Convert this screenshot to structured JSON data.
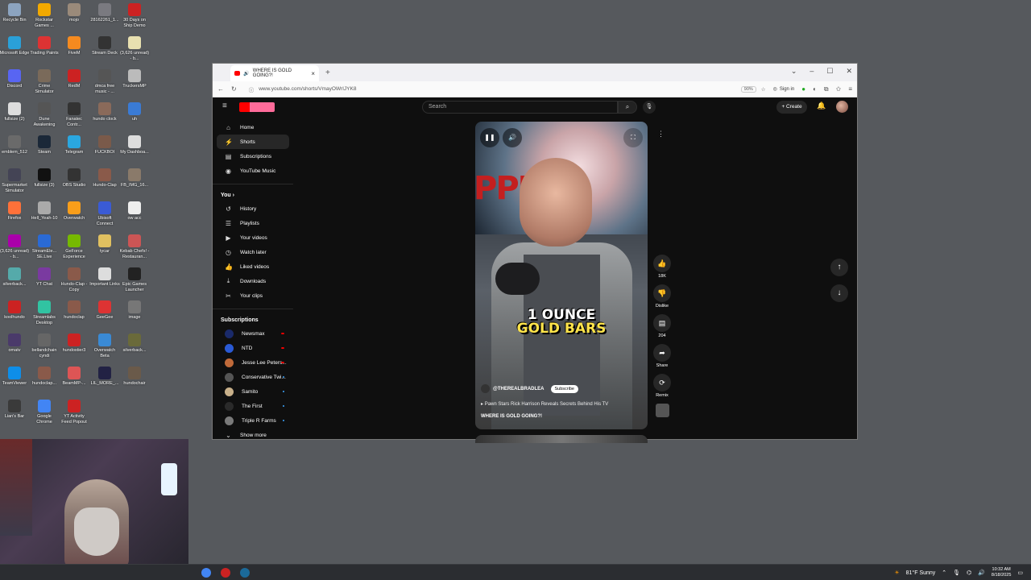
{
  "desktop": {
    "icons": [
      {
        "label": "Recycle Bin",
        "color": "#8ca4c0"
      },
      {
        "label": "Rockstar Games ...",
        "color": "#f2a900"
      },
      {
        "label": "mojo",
        "color": "#9a8a7a"
      },
      {
        "label": "28162261_1...",
        "color": "#7a7a80"
      },
      {
        "label": "30 Days on Ship Demo",
        "color": "#c22"
      },
      {
        "label": "Microsoft Edge",
        "color": "#2aa0d8"
      },
      {
        "label": "Trading Paints",
        "color": "#d33"
      },
      {
        "label": "FiveM",
        "color": "#f58a1f"
      },
      {
        "label": "Stream Deck",
        "color": "#333"
      },
      {
        "label": "(3,626 unread) - b...",
        "color": "#e8e0b0"
      },
      {
        "label": "Discord",
        "color": "#5865f2"
      },
      {
        "label": "Crime Simulator",
        "color": "#7a6a5a"
      },
      {
        "label": "RedM",
        "color": "#c22"
      },
      {
        "label": "dmca free music - ...",
        "color": "#555"
      },
      {
        "label": "TruckersMP",
        "color": "#bbb"
      },
      {
        "label": "fullsize (2)",
        "color": "#ddd"
      },
      {
        "label": "Dune Awakening",
        "color": "#555"
      },
      {
        "label": "Fanatec Contr...",
        "color": "#333"
      },
      {
        "label": "hundo clock",
        "color": "#8a6a5a"
      },
      {
        "label": "uh",
        "color": "#3a7bd5"
      },
      {
        "label": "emblem_512",
        "color": "#6a6a6a"
      },
      {
        "label": "Steam",
        "color": "#1b2838"
      },
      {
        "label": "Telegram",
        "color": "#2aa7e0"
      },
      {
        "label": "FUCKBOI",
        "color": "#7a5a4a"
      },
      {
        "label": "My Dashboa...",
        "color": "#ddd"
      },
      {
        "label": "Supermarket Simulator",
        "color": "#445"
      },
      {
        "label": "fullsize (3)",
        "color": "#111"
      },
      {
        "label": "OBS Studio",
        "color": "#333"
      },
      {
        "label": "Hundo-Clap",
        "color": "#8a5a4a"
      },
      {
        "label": "FB_IMG_16...",
        "color": "#8a7a6a"
      },
      {
        "label": "Firefox",
        "color": "#ff7139"
      },
      {
        "label": "Hell_Yeah-10",
        "color": "#aaa"
      },
      {
        "label": "Overwatch",
        "color": "#f99e1a"
      },
      {
        "label": "Ubisoft Connect",
        "color": "#3a5bd5"
      },
      {
        "label": "ow acc",
        "color": "#eee"
      },
      {
        "label": "(3,626 unread) - b...",
        "color": "#a0a"
      },
      {
        "label": "StreamEle... SE.Live",
        "color": "#2a6ad5"
      },
      {
        "label": "GeForce Experience",
        "color": "#76b900"
      },
      {
        "label": "tycar",
        "color": "#e0c060"
      },
      {
        "label": "Kebab Chefs! - Restauran...",
        "color": "#c55"
      },
      {
        "label": "silverback...",
        "color": "#5aa"
      },
      {
        "label": "YT Chat",
        "color": "#7a3aa0"
      },
      {
        "label": "Hundo-Clap - Copy",
        "color": "#8a5a4a"
      },
      {
        "label": "Important Links",
        "color": "#ddd"
      },
      {
        "label": "Epic Games Launcher",
        "color": "#222"
      },
      {
        "label": "koolhundo",
        "color": "#c22"
      },
      {
        "label": "Streamlabs Desktop",
        "color": "#31c3a2"
      },
      {
        "label": "hundoclap",
        "color": "#8a5a4a"
      },
      {
        "label": "GeeGee",
        "color": "#d33"
      },
      {
        "label": "image",
        "color": "#777"
      },
      {
        "label": "omatv",
        "color": "#4a3a6a"
      },
      {
        "label": "bellandchain cyndi",
        "color": "#666"
      },
      {
        "label": "hundostier3",
        "color": "#c22"
      },
      {
        "label": "Overwatch Beta",
        "color": "#3a8ad5"
      },
      {
        "label": "silverback...",
        "color": "#6a6a3a"
      },
      {
        "label": "TeamViewer",
        "color": "#0e8ee9"
      },
      {
        "label": "hundoclap...",
        "color": "#8a5a4a"
      },
      {
        "label": "BeamMP-...",
        "color": "#d55"
      },
      {
        "label": "LIL_MORE_...",
        "color": "#224"
      },
      {
        "label": "hundochair",
        "color": "#6a5a4a"
      },
      {
        "label": "Lian's Bar",
        "color": "#3a3a3a"
      },
      {
        "label": "Google Chrome",
        "color": "#4285f4"
      },
      {
        "label": "YT Activity Feed Popout",
        "color": "#c22"
      }
    ]
  },
  "taskbar": {
    "weather": "81°F  Sunny",
    "time": "10:32 AM",
    "date": "8/18/2025"
  },
  "browser": {
    "tab_title": "WHERE IS GOLD GOING?!",
    "url": "www.youtube.com/shorts/VmayOWrIJYK8",
    "zoom": "90%",
    "signin": "Sign in"
  },
  "youtube": {
    "search_placeholder": "Search",
    "create_label": "Create",
    "sidebar_main": [
      {
        "label": "Home",
        "icon": "home-icon",
        "glyph": "⌂"
      },
      {
        "label": "Shorts",
        "icon": "shorts-icon",
        "glyph": "⚡"
      },
      {
        "label": "Subscriptions",
        "icon": "subscriptions-icon",
        "glyph": "▤"
      },
      {
        "label": "YouTube Music",
        "icon": "music-icon",
        "glyph": "◉"
      }
    ],
    "you_label": "You",
    "sidebar_you": [
      {
        "label": "History",
        "icon": "history-icon",
        "glyph": "↺"
      },
      {
        "label": "Playlists",
        "icon": "playlists-icon",
        "glyph": "☰"
      },
      {
        "label": "Your videos",
        "icon": "your-videos-icon",
        "glyph": "▶"
      },
      {
        "label": "Watch later",
        "icon": "watch-later-icon",
        "glyph": "◷"
      },
      {
        "label": "Liked videos",
        "icon": "liked-videos-icon",
        "glyph": "👍"
      },
      {
        "label": "Downloads",
        "icon": "downloads-icon",
        "glyph": "⤓"
      },
      {
        "label": "Your clips",
        "icon": "clips-icon",
        "glyph": "✂"
      }
    ],
    "subscriptions_heading": "Subscriptions",
    "subscriptions": [
      {
        "label": "Newsmax",
        "color": "#1a2a6a",
        "live": true
      },
      {
        "label": "NTD",
        "color": "#2a5ad5",
        "live": true
      },
      {
        "label": "Jesse Lee Peters...",
        "color": "#c06a3a",
        "live": true
      },
      {
        "label": "Conservative Twi...",
        "color": "#555",
        "live": false
      },
      {
        "label": "Samito",
        "color": "#c8b08a",
        "live": false
      },
      {
        "label": "The First",
        "color": "#2a2a2a",
        "live": false
      },
      {
        "label": "Triple R Farms",
        "color": "#7a7a7a",
        "live": false
      }
    ],
    "show_more": "Show more",
    "short": {
      "caption_line1": "1 OUNCE",
      "caption_line2": "GOLD BARS",
      "channel": "@THEREALBRADLEA",
      "subscribe": "Subscribe",
      "description": "Pawn Stars Rick Harrison Reveals Secrets Behind His TV",
      "title": "WHERE IS GOLD GOING?!",
      "likes": "18K",
      "dislike": "Dislike",
      "comments": "204",
      "share": "Share",
      "remix": "Remix"
    }
  }
}
